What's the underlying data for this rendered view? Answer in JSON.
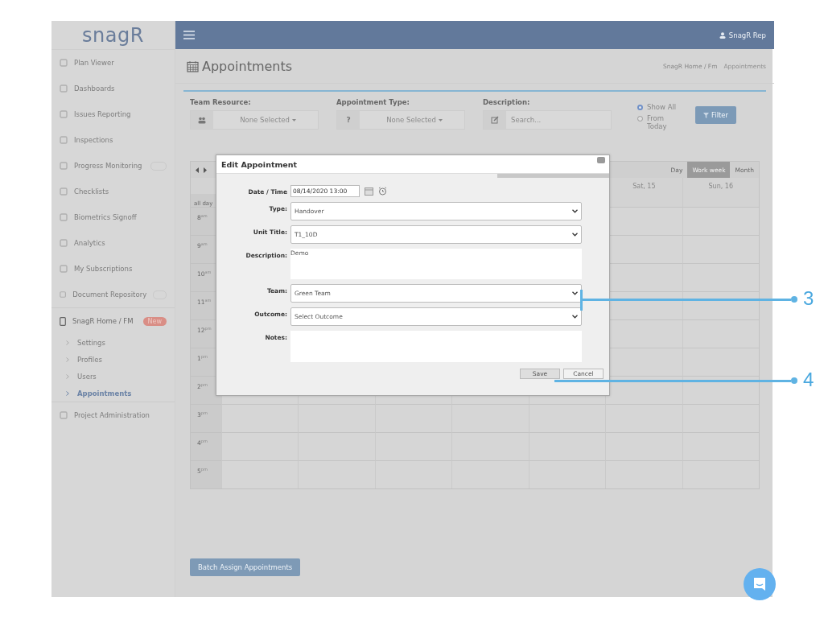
{
  "sidebar": {
    "logo": "snagR",
    "items": [
      {
        "label": "Plan Viewer",
        "has_badge": false
      },
      {
        "label": "Dashboards",
        "has_badge": false
      },
      {
        "label": "Issues Reporting",
        "has_badge": false
      },
      {
        "label": "Inspections",
        "has_badge": false
      },
      {
        "label": "Progress Monitoring",
        "has_badge": true
      },
      {
        "label": "Checklists",
        "has_badge": false
      },
      {
        "label": "Biometrics Signoff",
        "has_badge": false
      },
      {
        "label": "Analytics",
        "has_badge": false
      },
      {
        "label": "My Subscriptions",
        "has_badge": false
      },
      {
        "label": "Document Repository",
        "has_badge": true
      },
      {
        "label": "SnagR Home / FM",
        "badge": "New",
        "expanded": true,
        "children": [
          {
            "label": "Settings",
            "selected": false
          },
          {
            "label": "Profiles",
            "selected": false
          },
          {
            "label": "Users",
            "selected": false
          },
          {
            "label": "Appointments",
            "selected": true
          }
        ]
      },
      {
        "label": "Project Administration",
        "has_badge": false
      }
    ]
  },
  "header": {
    "user": "SnagR Rep"
  },
  "page": {
    "title": "Appointments",
    "breadcrumb": [
      "SnagR Home / Fm",
      "Appointments"
    ]
  },
  "filters": [
    {
      "label": "Team Resource:",
      "kind": "dropdown",
      "value": "None Selected"
    },
    {
      "label": "Appointment Type:",
      "kind": "dropdown",
      "addon": "?",
      "value": "None Selected"
    },
    {
      "label": "Description:",
      "kind": "search",
      "placeholder": "Search..."
    }
  ],
  "range_options": [
    {
      "label": "Show All",
      "selected": true
    },
    {
      "label": "From Today",
      "selected": false
    }
  ],
  "filter_button": "Filter",
  "calendar": {
    "views": [
      {
        "label": "Day",
        "selected": false
      },
      {
        "label": "Work week",
        "selected": true
      },
      {
        "label": "Month",
        "selected": false
      }
    ],
    "visible_days": [
      "Sat, 15",
      "Sun, 16"
    ],
    "all_day": "all day",
    "hours": [
      "8$^{am}$",
      "9$^{am}$",
      "10$^{am}$",
      "11$^{am}$",
      "12$^{pm}$",
      "1$^{pm}$",
      "2$^{pm}$",
      "3$^{pm}$",
      "4$^{pm}$",
      "5$^{pm}$"
    ]
  },
  "batch_button": "Batch Assign Appointments",
  "dialog": {
    "title": "Edit Appointment",
    "fields": [
      {
        "label": "Date / Time",
        "kind": "datetime",
        "value": "08/14/2020 13:00"
      },
      {
        "label": "Type:",
        "kind": "select",
        "value": "Handover"
      },
      {
        "label": "Unit Title:",
        "kind": "select",
        "value": "T1_10D"
      },
      {
        "label": "Description:",
        "kind": "textarea",
        "value": "Demo"
      },
      {
        "label": "Team:",
        "kind": "select",
        "value": "Green Team"
      },
      {
        "label": "Outcome:",
        "kind": "select",
        "value": "Select Outcome"
      },
      {
        "label": "Notes:",
        "kind": "textarea"
      }
    ],
    "buttons": [
      "Save",
      "Cancel"
    ]
  },
  "callouts": [
    {
      "number": "3"
    },
    {
      "number": "4"
    }
  ]
}
